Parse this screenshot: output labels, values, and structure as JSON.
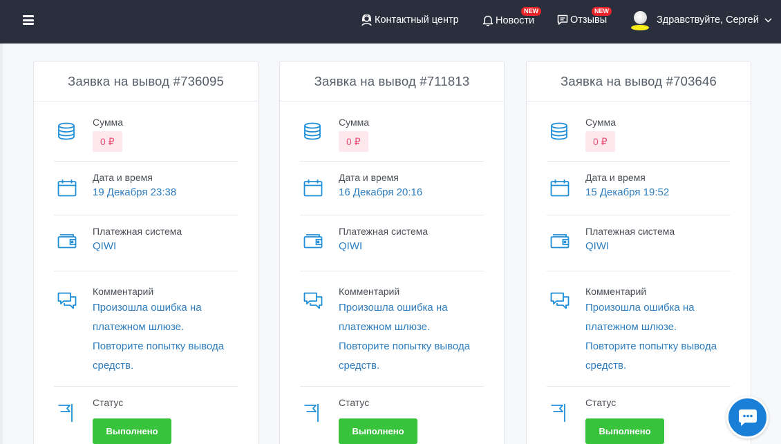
{
  "header": {
    "contact_center": "Контактный центр",
    "news": "Новости",
    "news_badge": "NEW",
    "reviews": "Отзывы",
    "reviews_badge": "NEW",
    "greeting": "Здравствуйте, Сергей"
  },
  "labels": {
    "sum": "Сумма",
    "datetime": "Дата и время",
    "payment": "Платежная система",
    "comment": "Комментарий",
    "status": "Статус"
  },
  "cards": [
    {
      "title": "Заявка на вывод #736095",
      "amount": "0 ₽",
      "datetime": "19 Декабря 23:38",
      "payment": "QIWI",
      "comment_lines": [
        "Произошла ошибка на",
        "платежном шлюзе.",
        "Повторите попытку вывода",
        "средств."
      ],
      "status": "Выполнено"
    },
    {
      "title": "Заявка на вывод #711813",
      "amount": "0 ₽",
      "datetime": "16 Декабря 20:16",
      "payment": "QIWI",
      "comment_lines": [
        "Произошла ошибка на",
        "платежном шлюзе.",
        "Повторите попытку вывода",
        "средств."
      ],
      "status": "Выполнено"
    },
    {
      "title": "Заявка на вывод #703646",
      "amount": "0 ₽",
      "datetime": "15 Декабря 19:52",
      "payment": "QIWI",
      "comment_lines": [
        "Произошла ошибка на",
        "платежном шлюзе.",
        "Повторите попытку вывода",
        "средств."
      ],
      "status": "Выполнено"
    }
  ],
  "colors": {
    "topbar": "#2a2f3d",
    "accent_blue": "#2d7dbf",
    "icon_blue": "#1e8fd8",
    "badge_red": "#e8262a",
    "status_green": "#37c33b",
    "amount_pink": "#ec4b72"
  },
  "icons": [
    "menu-icon",
    "headset-icon",
    "bell-icon",
    "chat-icon",
    "chevron-down-icon",
    "coins-icon",
    "calendar-icon",
    "wallet-icon",
    "comments-icon",
    "flag-icon"
  ]
}
